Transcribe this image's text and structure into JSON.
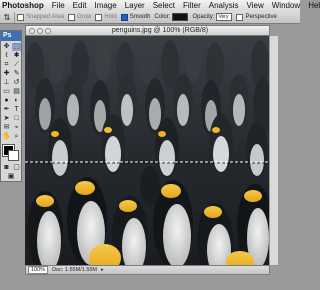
{
  "menubar": {
    "apple": "",
    "items": [
      "Photoshop",
      "File",
      "Edit",
      "Image",
      "Layer",
      "Select",
      "Filter",
      "Analysis",
      "View",
      "Window",
      "Help"
    ]
  },
  "options": {
    "tool_icon": "single-row-marquee-icon",
    "fringe": "Snapped Area",
    "grow": "Grow",
    "hold": "Hold",
    "smooth": "Smooth",
    "color_label": "Color:",
    "opacity_label": "Opacity:",
    "opacity_value": "Very",
    "perspective": "Perspective"
  },
  "tools": {
    "badge": "Ps"
  },
  "document": {
    "title": "penguins.jpg @ 100% (RGB/8)",
    "zoom": "100%",
    "doc_size": "Doc: 1.55M/1.55M"
  }
}
